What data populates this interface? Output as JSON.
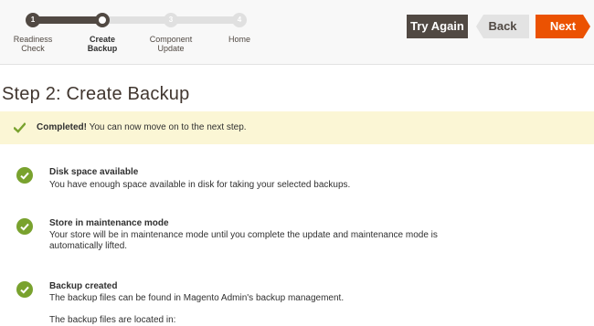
{
  "progress": {
    "steps": [
      {
        "num": "1",
        "label_line1": "Readiness",
        "label_line2": "Check",
        "state": "done"
      },
      {
        "num": "2",
        "label_line1": "Create",
        "label_line2": "Backup",
        "state": "current"
      },
      {
        "num": "3",
        "label_line1": "Component",
        "label_line2": "Update",
        "state": "todo"
      },
      {
        "num": "4",
        "label_line1": "Home",
        "label_line2": "",
        "state": "todo"
      }
    ]
  },
  "actions": {
    "try_again_label": "Try Again",
    "back_label": "Back",
    "next_label": "Next"
  },
  "page": {
    "title": "Step 2: Create Backup"
  },
  "notice": {
    "strong": "Completed!",
    "text": " You can now move on to the next step.",
    "icon": "check-icon"
  },
  "checks": [
    {
      "title": "Disk space available",
      "desc": "You have enough space available in disk for taking your selected backups.",
      "icon": "check-circle-icon"
    },
    {
      "title": "Store in maintenance mode",
      "desc": "Your store will be in maintenance mode until you complete the update and maintenance mode is automatically lifted.",
      "icon": "check-circle-icon"
    },
    {
      "title": "Backup created",
      "desc": "The backup files can be found in Magento Admin's backup management.",
      "desc2": "The backup files are located in:",
      "icon": "check-circle-icon"
    }
  ],
  "colors": {
    "brand_dark": "#514943",
    "accent_orange": "#eb5202",
    "success_green": "#79a22e",
    "notice_bg": "#fbf6d5"
  }
}
